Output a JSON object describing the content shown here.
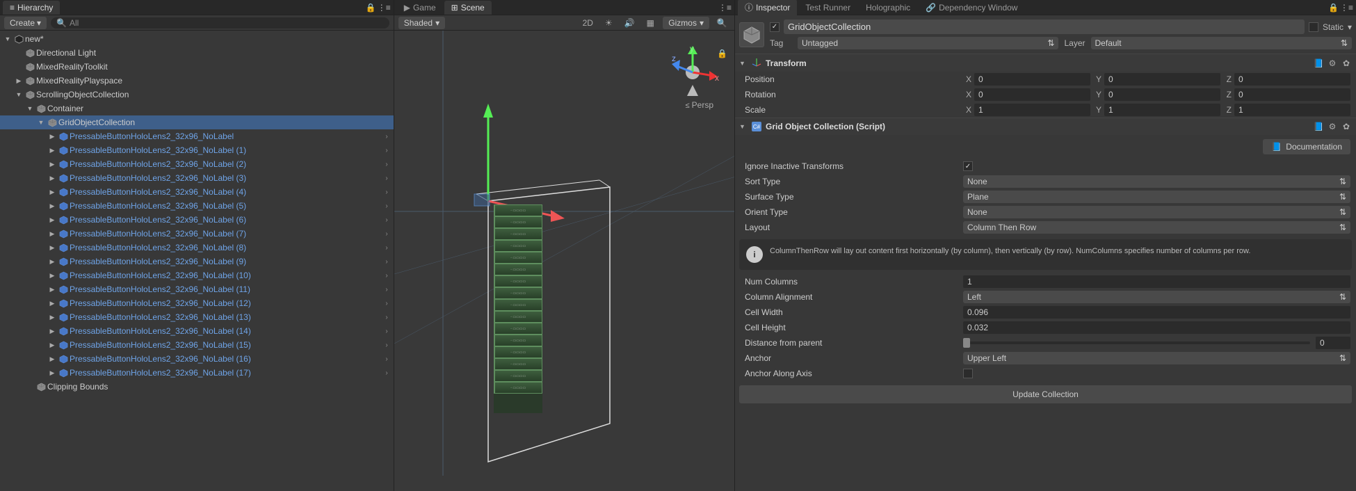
{
  "hierarchy": {
    "title": "Hierarchy",
    "create_label": "Create",
    "search_placeholder": "All",
    "scene_name": "new*",
    "roots": [
      {
        "label": "Directional Light",
        "prefab": false,
        "children": false,
        "indent": 1
      },
      {
        "label": "MixedRealityToolkit",
        "prefab": false,
        "children": false,
        "indent": 1
      },
      {
        "label": "MixedRealityPlayspace",
        "prefab": false,
        "children": true,
        "expanded": false,
        "indent": 1
      },
      {
        "label": "ScrollingObjectCollection",
        "prefab": false,
        "children": true,
        "expanded": true,
        "indent": 1
      }
    ],
    "container_label": "Container",
    "grid_label": "GridObjectCollection",
    "buttons": [
      "PressableButtonHoloLens2_32x96_NoLabel",
      "PressableButtonHoloLens2_32x96_NoLabel (1)",
      "PressableButtonHoloLens2_32x96_NoLabel (2)",
      "PressableButtonHoloLens2_32x96_NoLabel (3)",
      "PressableButtonHoloLens2_32x96_NoLabel (4)",
      "PressableButtonHoloLens2_32x96_NoLabel (5)",
      "PressableButtonHoloLens2_32x96_NoLabel (6)",
      "PressableButtonHoloLens2_32x96_NoLabel (7)",
      "PressableButtonHoloLens2_32x96_NoLabel (8)",
      "PressableButtonHoloLens2_32x96_NoLabel (9)",
      "PressableButtonHoloLens2_32x96_NoLabel (10)",
      "PressableButtonHoloLens2_32x96_NoLabel (11)",
      "PressableButtonHoloLens2_32x96_NoLabel (12)",
      "PressableButtonHoloLens2_32x96_NoLabel (13)",
      "PressableButtonHoloLens2_32x96_NoLabel (14)",
      "PressableButtonHoloLens2_32x96_NoLabel (15)",
      "PressableButtonHoloLens2_32x96_NoLabel (16)",
      "PressableButtonHoloLens2_32x96_NoLabel (17)"
    ],
    "clipping_label": "Clipping Bounds"
  },
  "scene": {
    "tabs": {
      "game": "Game",
      "scene": "Scene"
    },
    "shaded": "Shaded",
    "mode_2d": "2D",
    "gizmos": "Gizmos",
    "persp": "Persp",
    "axes": {
      "x": "x",
      "y": "y",
      "z": "z"
    }
  },
  "inspector": {
    "tabs": {
      "inspector": "Inspector",
      "test_runner": "Test Runner",
      "holographic": "Holographic",
      "dependency": "Dependency Window"
    },
    "object_name": "GridObjectCollection",
    "static_label": "Static",
    "tag_label": "Tag",
    "tag_value": "Untagged",
    "layer_label": "Layer",
    "layer_value": "Default",
    "transform": {
      "title": "Transform",
      "position_label": "Position",
      "rotation_label": "Rotation",
      "scale_label": "Scale",
      "axes": {
        "x": "X",
        "y": "Y",
        "z": "Z"
      },
      "pos": {
        "x": "0",
        "y": "0",
        "z": "0"
      },
      "rot": {
        "x": "0",
        "y": "0",
        "z": "0"
      },
      "scale": {
        "x": "1",
        "y": "1",
        "z": "1"
      }
    },
    "grid_component": {
      "title": "Grid Object Collection (Script)",
      "doc_label": "Documentation",
      "ignore_label": "Ignore Inactive Transforms",
      "ignore_checked": true,
      "sort_label": "Sort Type",
      "sort_value": "None",
      "surface_label": "Surface Type",
      "surface_value": "Plane",
      "orient_label": "Orient Type",
      "orient_value": "None",
      "layout_label": "Layout",
      "layout_value": "Column Then Row",
      "info_text": "ColumnThenRow will lay out content first horizontally (by column), then vertically (by row). NumColumns specifies number of columns per row.",
      "numcols_label": "Num Columns",
      "numcols_value": "1",
      "colalign_label": "Column Alignment",
      "colalign_value": "Left",
      "cellw_label": "Cell Width",
      "cellw_value": "0.096",
      "cellh_label": "Cell Height",
      "cellh_value": "0.032",
      "dist_label": "Distance from parent",
      "dist_value": "0",
      "anchor_label": "Anchor",
      "anchor_value": "Upper Left",
      "anchoraxis_label": "Anchor Along Axis",
      "update_label": "Update Collection"
    }
  }
}
